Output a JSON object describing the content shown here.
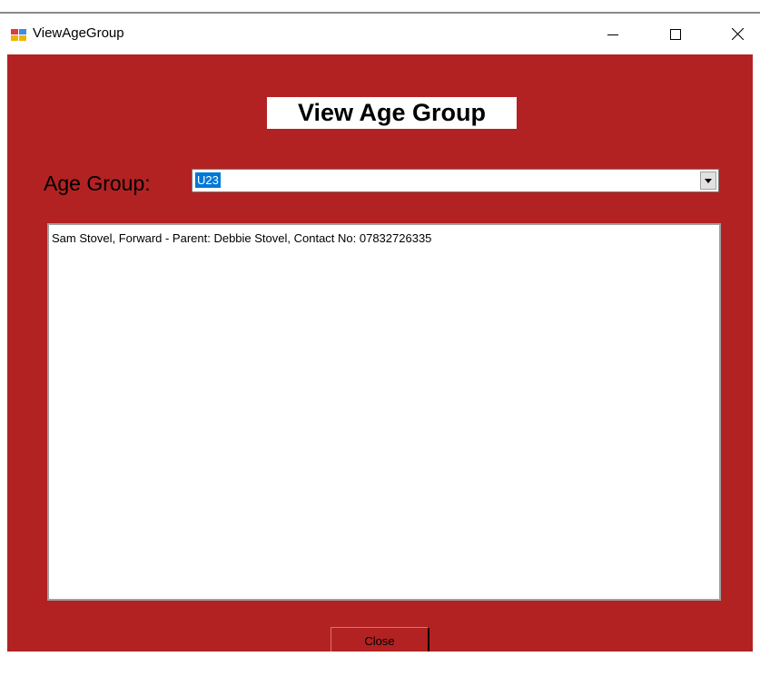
{
  "window": {
    "title": "ViewAgeGroup",
    "controls": [
      "minimize-icon",
      "maximize-icon",
      "close-icon"
    ]
  },
  "form": {
    "heading": "View Age Group",
    "age_group_label": "Age Group:",
    "age_group_value": "U23",
    "list_items": [
      "Sam Stovel, Forward - Parent: Debbie Stovel, Contact No: 07832726335"
    ],
    "close_label": "Close"
  },
  "colors": {
    "background": "#b22222",
    "selection": "#0078d7"
  }
}
